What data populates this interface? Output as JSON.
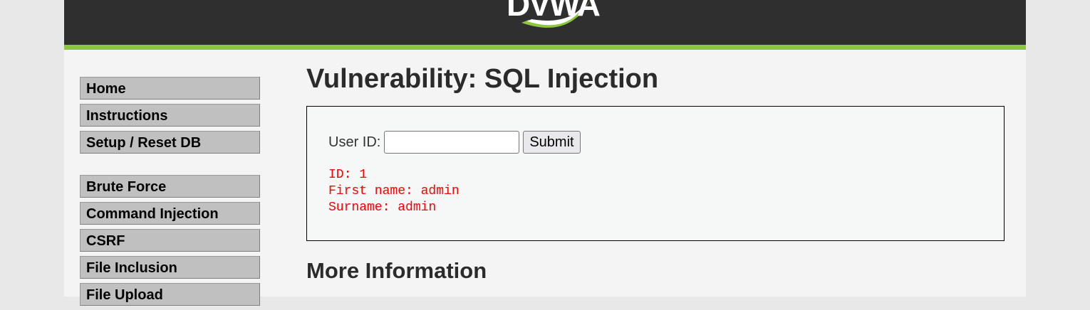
{
  "header": {
    "logo_text": "DVWA",
    "accent_color": "#8dc63f",
    "background_color": "#2f2f2f"
  },
  "menu": {
    "group1": [
      {
        "label": "Home"
      },
      {
        "label": "Instructions"
      },
      {
        "label": "Setup / Reset DB"
      }
    ],
    "group2": [
      {
        "label": "Brute Force"
      },
      {
        "label": "Command Injection"
      },
      {
        "label": "CSRF"
      },
      {
        "label": "File Inclusion"
      },
      {
        "label": "File Upload"
      }
    ]
  },
  "main": {
    "title": "Vulnerability: SQL Injection",
    "form": {
      "label": "User ID:",
      "input_value": "",
      "submit_label": "Submit"
    },
    "result": {
      "color": "#ff0000",
      "lines": [
        "ID: 1",
        "First name: admin",
        "Surname: admin"
      ]
    },
    "more_info_heading": "More Information"
  }
}
